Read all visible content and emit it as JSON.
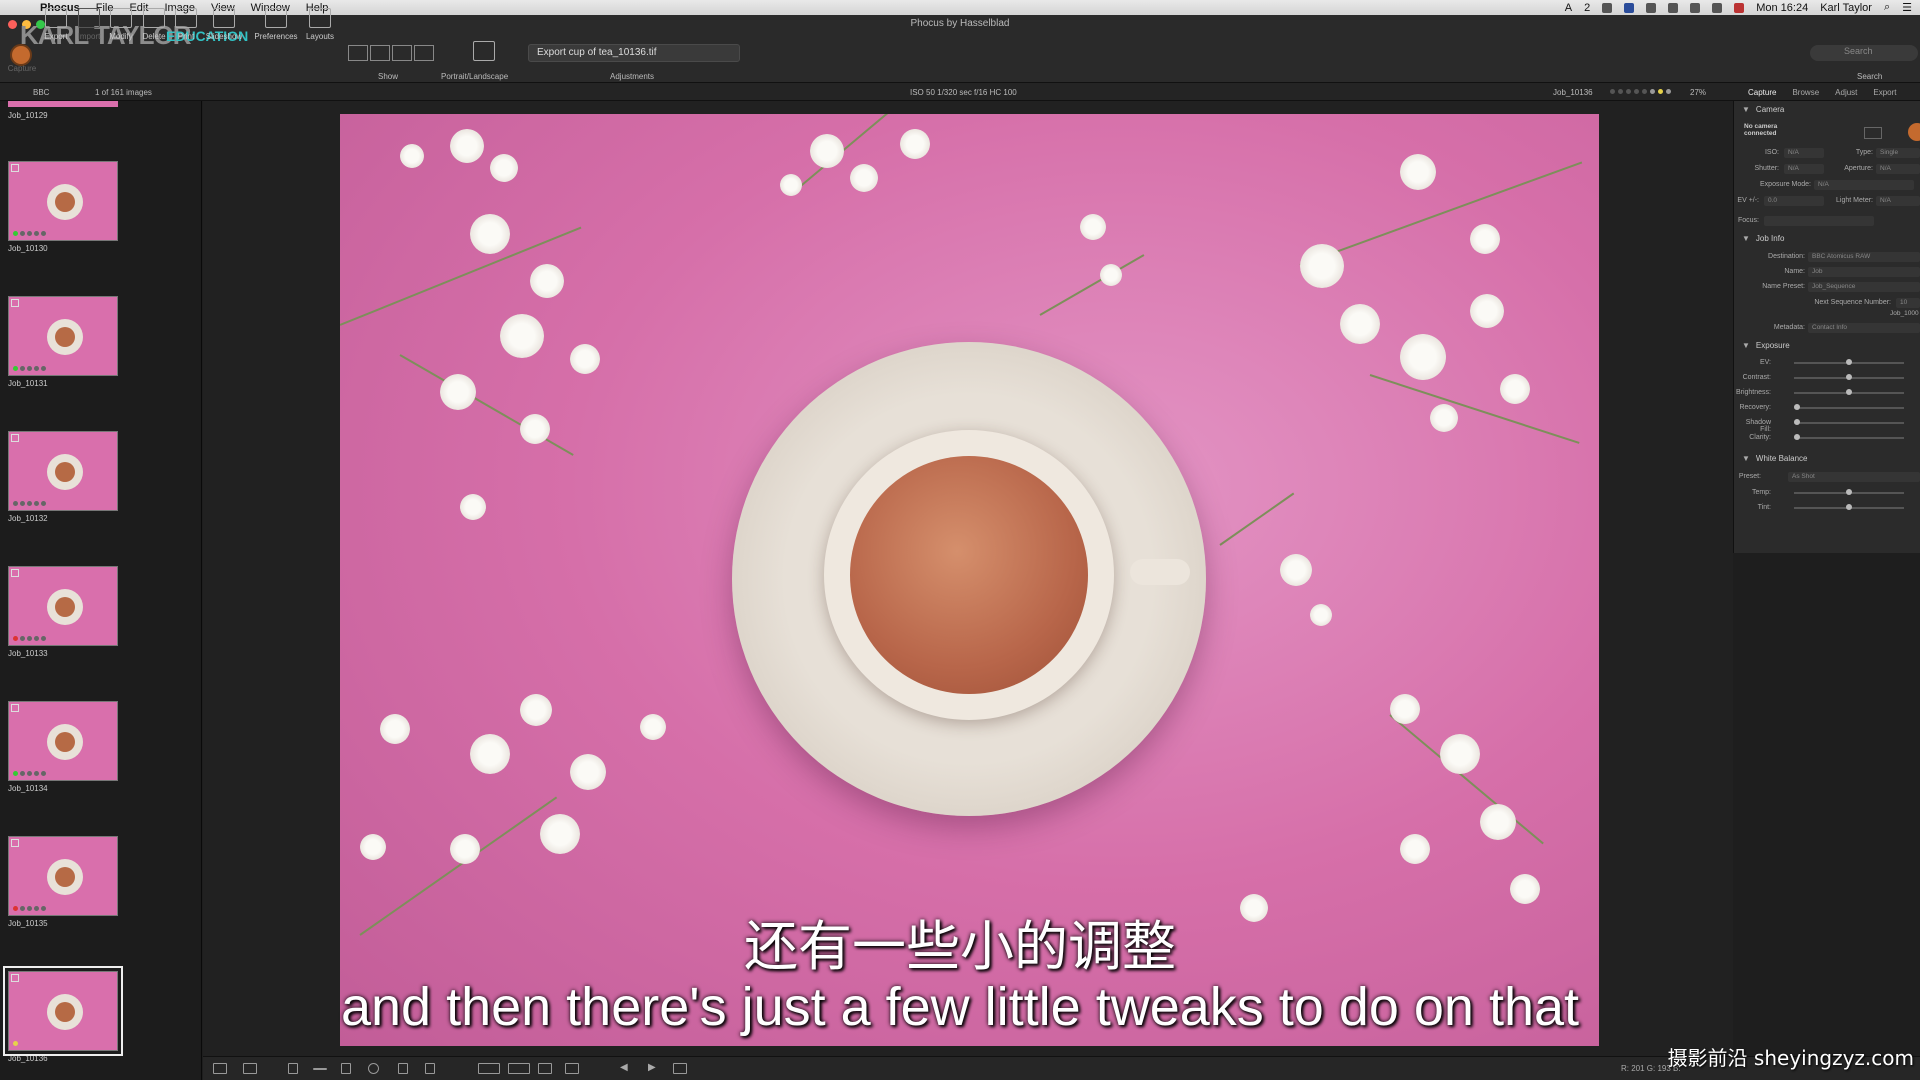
{
  "menubar": {
    "app": "Phocus",
    "items": [
      "File",
      "Edit",
      "Image",
      "View",
      "Window",
      "Help"
    ],
    "status_text": "2",
    "clock": "Mon 16:24",
    "user": "Karl Taylor"
  },
  "window": {
    "title": "Phocus by Hasselblad"
  },
  "brand": {
    "name": "KARL TAYLOR",
    "sub": "EDUCATION"
  },
  "toolbar": {
    "capture": "Capture",
    "export": "Export",
    "import": "Import",
    "modify": "Modify",
    "delete": "Delete",
    "print": "Print",
    "slideshow": "Slideshow",
    "preferences": "Preferences",
    "layouts": "Layouts",
    "show": "Show",
    "portrait_landscape": "Portrait/Landscape",
    "adjustments": "Adjustments",
    "search": "Search",
    "search_placeholder": "Search",
    "export_name": "Export cup of tea_10136.tif"
  },
  "infobar": {
    "folder": "BBC",
    "count": "1 of 161 images",
    "exposure": "ISO 50  1/320 sec  f/16  HC 100",
    "current_file": "Job_10136",
    "zoom": "27%",
    "tabs": [
      "Capture",
      "Browse",
      "Adjust",
      "Export"
    ]
  },
  "browser": {
    "partial_label": "Job_10129",
    "thumbs": [
      {
        "name": "Job_10130"
      },
      {
        "name": "Job_10131"
      },
      {
        "name": "Job_10132"
      },
      {
        "name": "Job_10133"
      },
      {
        "name": "Job_10134"
      },
      {
        "name": "Job_10135"
      },
      {
        "name": "Job_10136"
      }
    ]
  },
  "panel": {
    "camera": {
      "title": "Camera",
      "status": "No camera connected",
      "iso_label": "ISO:",
      "iso": "N/A",
      "type_label": "Type:",
      "type": "Single",
      "shutter_label": "Shutter:",
      "shutter": "N/A",
      "aperture_label": "Aperture:",
      "aperture": "N/A",
      "exposure_mode_label": "Exposure Mode:",
      "exposure_mode": "N/A",
      "ev_label": "EV +/-:",
      "ev": "0.0",
      "light_meter_label": "Light Meter:",
      "light_meter": "N/A",
      "focus_label": "Focus:"
    },
    "job_info": {
      "title": "Job Info",
      "destination_label": "Destination:",
      "destination": "BBC Atomicus RAW",
      "name_label": "Name:",
      "name": "Job",
      "name_preset_label": "Name Preset:",
      "name_preset": "Job_Sequence",
      "next_seq_label": "Next Sequence Number:",
      "next_seq": "10",
      "next_job": "Job_1000",
      "metadata_label": "Metadata:",
      "metadata": "Contact Info"
    },
    "exposure": {
      "title": "Exposure",
      "sliders": [
        {
          "label": "EV:",
          "value": 0.5
        },
        {
          "label": "Contrast:",
          "value": 0.5
        },
        {
          "label": "Brightness:",
          "value": 0.5
        },
        {
          "label": "Recovery:",
          "value": 0.0
        },
        {
          "label": "Shadow Fill:",
          "value": 0.0
        },
        {
          "label": "Clarity:",
          "value": 0.0
        }
      ]
    },
    "white_balance": {
      "title": "White Balance",
      "preset_label": "Preset:",
      "preset": "As Shot",
      "sliders": [
        {
          "label": "Temp:",
          "value": 0.5
        },
        {
          "label": "Tint:",
          "value": 0.5
        }
      ]
    }
  },
  "bottombar": {
    "coords": "R: 201  G: 193  B:"
  },
  "subtitles": {
    "chinese": "还有一些小的调整",
    "english": "and then there's just a few little tweaks to do on that"
  },
  "watermark": "摄影前沿 sheyingzyz.com",
  "colors": {
    "accent": "#31c2c4",
    "background": "#1e1e1e",
    "photo_pink": "#d66fa9"
  }
}
